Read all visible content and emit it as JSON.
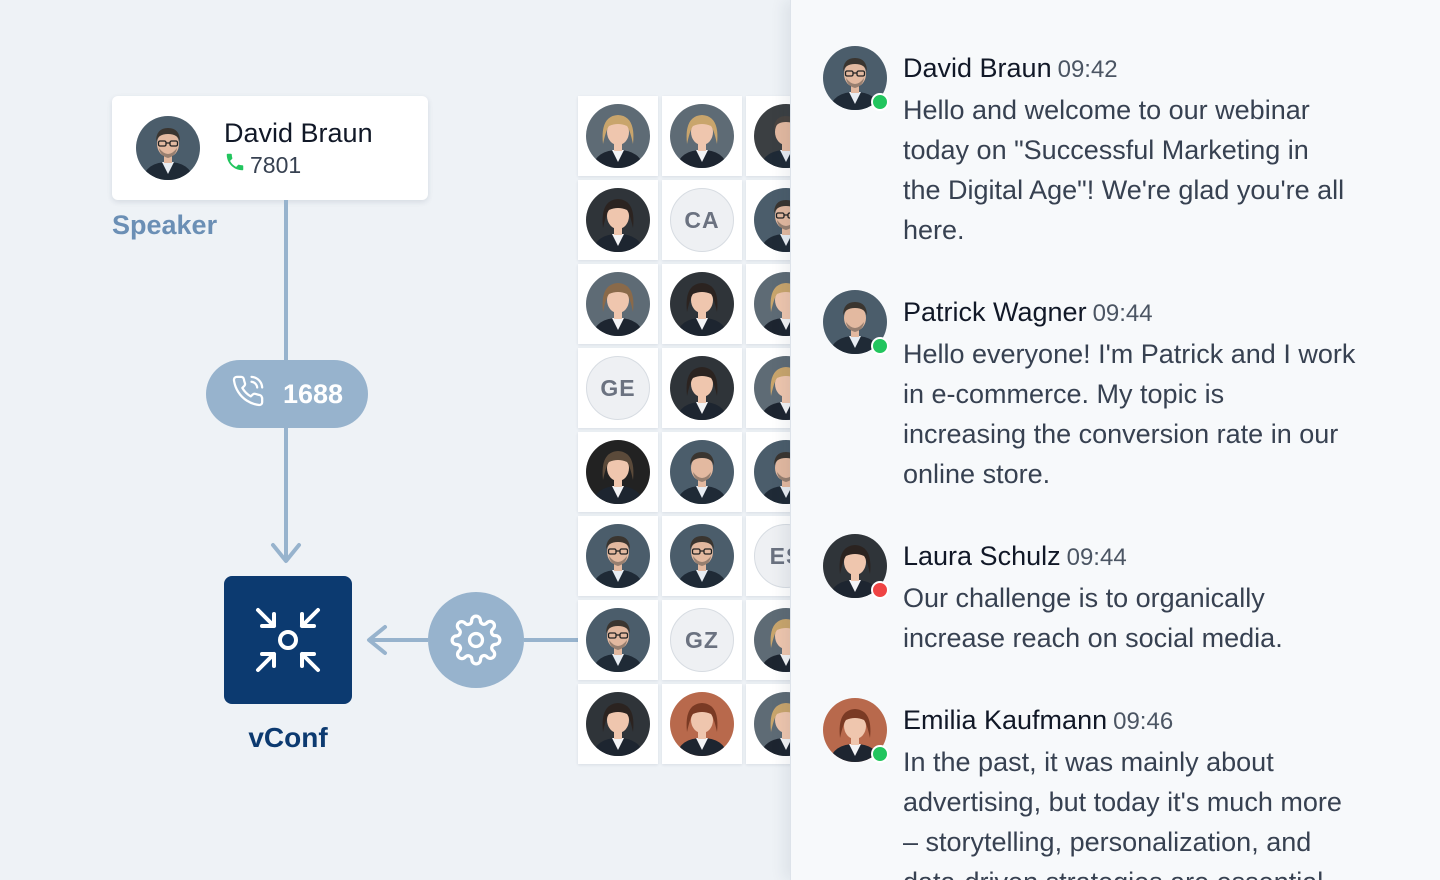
{
  "speaker": {
    "name": "David Braun",
    "extension": "7801",
    "label": "Speaker"
  },
  "call": {
    "number": "1688"
  },
  "vconf": {
    "label": "vConf"
  },
  "colors": {
    "accent": "#97b3cd",
    "brand": "#0c3a70",
    "online": "#22c55e",
    "busy": "#ef4444",
    "phone_green": "#22c55e"
  },
  "participants": [
    {
      "type": "photo",
      "variant": "woman-blonde"
    },
    {
      "type": "photo",
      "variant": "woman-blonde-2"
    },
    {
      "type": "photo",
      "variant": "man-curly"
    },
    {
      "type": "photo",
      "variant": "woman-dark"
    },
    {
      "type": "initials",
      "initials": "CA"
    },
    {
      "type": "photo",
      "variant": "man-glasses"
    },
    {
      "type": "photo",
      "variant": "woman-smile"
    },
    {
      "type": "photo",
      "variant": "woman-dark-2"
    },
    {
      "type": "photo",
      "variant": "woman-blonde-3"
    },
    {
      "type": "initials",
      "initials": "GE"
    },
    {
      "type": "photo",
      "variant": "woman-dark-3"
    },
    {
      "type": "photo",
      "variant": "woman-blonde-4"
    },
    {
      "type": "photo",
      "variant": "woman-short"
    },
    {
      "type": "photo",
      "variant": "man-beard"
    },
    {
      "type": "photo",
      "variant": "man-beard-2"
    },
    {
      "type": "photo",
      "variant": "man-glasses-2"
    },
    {
      "type": "photo",
      "variant": "man-glasses-3"
    },
    {
      "type": "initials",
      "initials": "ES"
    },
    {
      "type": "photo",
      "variant": "man-glasses-4"
    },
    {
      "type": "initials",
      "initials": "GZ"
    },
    {
      "type": "photo",
      "variant": "woman-blonde-5"
    },
    {
      "type": "photo",
      "variant": "woman-dark-4"
    },
    {
      "type": "photo",
      "variant": "woman-red"
    },
    {
      "type": "photo",
      "variant": "woman-blonde-6"
    }
  ],
  "chat": {
    "messages": [
      {
        "name": "David Braun",
        "time": "09:42",
        "status": "online",
        "lines": [
          "Hello and welcome to our webinar",
          "today on \"Successful Marketing in",
          "the Digital Age\"! We're glad you're all",
          "here."
        ]
      },
      {
        "name": "Patrick Wagner",
        "time": "09:44",
        "status": "online",
        "lines": [
          "Hello everyone! I'm Patrick and I work",
          "in e-commerce. My topic is",
          "increasing the conversion rate in our",
          "online store."
        ]
      },
      {
        "name": "Laura Schulz",
        "time": "09:44",
        "status": "busy",
        "lines": [
          "Our challenge is to organically",
          "increase reach on social media."
        ]
      },
      {
        "name": "Emilia Kaufmann",
        "time": "09:46",
        "status": "online",
        "lines": [
          "In the past, it was mainly about",
          "advertising, but today it's much more",
          "– storytelling, personalization, and",
          "data-driven strategies are essential."
        ]
      }
    ]
  }
}
